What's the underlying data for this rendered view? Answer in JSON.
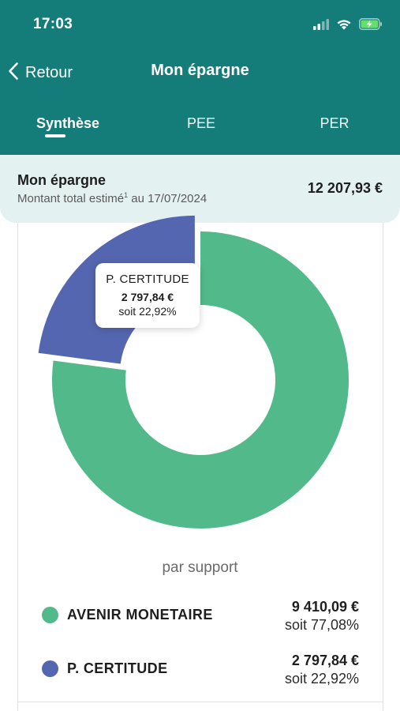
{
  "status_bar": {
    "time": "17:03",
    "icons": [
      "cellular-signal-icon",
      "wifi-icon",
      "battery-charging-icon"
    ]
  },
  "nav": {
    "back_label": "Retour",
    "title": "Mon épargne"
  },
  "tabs": [
    {
      "label": "Synthèse",
      "active": true
    },
    {
      "label": "PEE",
      "active": false
    },
    {
      "label": "PER",
      "active": false
    }
  ],
  "summary": {
    "title": "Mon épargne",
    "subtitle_prefix": "Montant total estimé",
    "footnote": "1",
    "subtitle_suffix": " au 17/07/2024",
    "total": "12 207,93 €"
  },
  "colors": {
    "header": "#147d7a",
    "summary_bg": "#e4f1f1",
    "avenir": "#52b98b",
    "certitude": "#5566b0"
  },
  "tooltip": {
    "name": "P. CERTITUDE",
    "amount": "2 797,84 €",
    "percent": "soit 22,92%"
  },
  "chart_caption": "par support",
  "chart_data": {
    "type": "pie",
    "categories": [
      "AVENIR MONETAIRE",
      "P. CERTITUDE"
    ],
    "values": [
      9410.09,
      2797.84
    ],
    "percent": [
      77.08,
      22.92
    ],
    "colors": [
      "#52b98b",
      "#5566b0"
    ],
    "donut": true,
    "selected": "P. CERTITUDE",
    "title": "",
    "legend": "bottom"
  },
  "legend": [
    {
      "name": "AVENIR MONETAIRE",
      "amount": "9 410,09 €",
      "percent": "soit 77,08%",
      "color": "#52b98b"
    },
    {
      "name": "P. CERTITUDE",
      "amount": "2 797,84 €",
      "percent": "soit 22,92%",
      "color": "#5566b0"
    }
  ]
}
